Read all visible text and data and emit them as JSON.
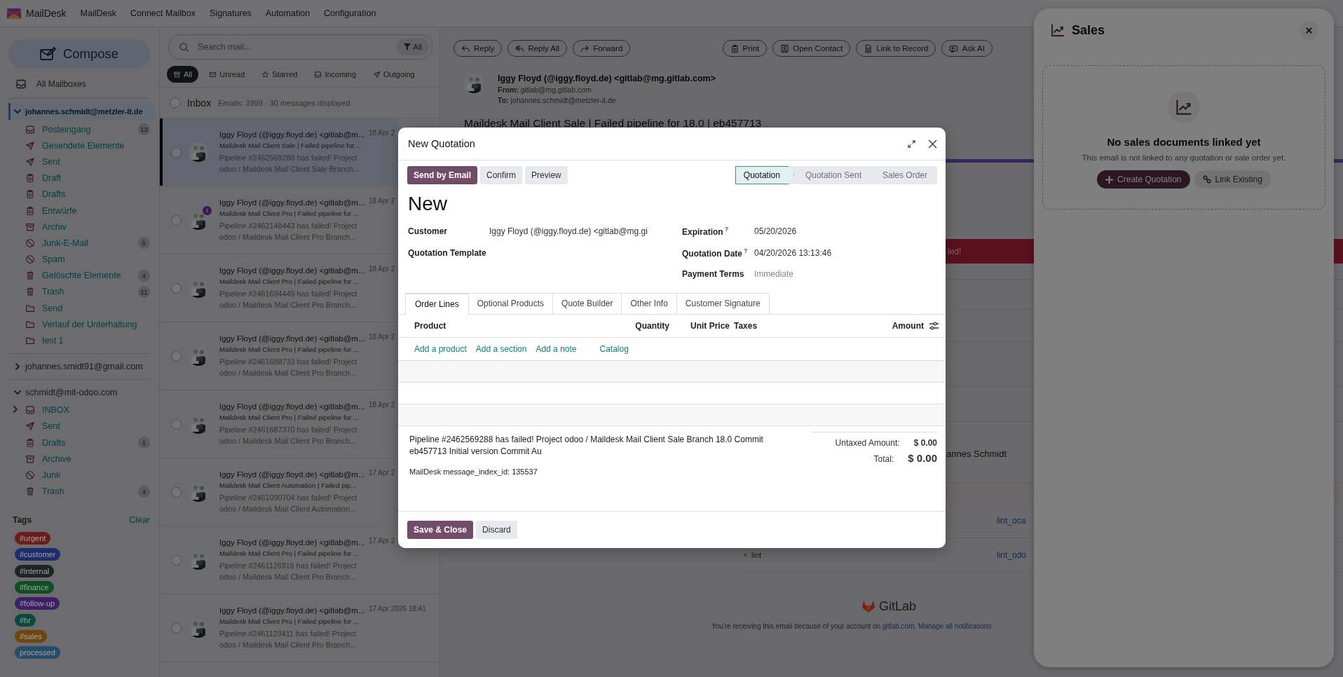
{
  "topbar": {
    "brand": "MailDesk",
    "menu": [
      "MailDesk",
      "Connect Mailbox",
      "Signatures",
      "Automation",
      "Configuration"
    ]
  },
  "sidebar": {
    "compose": "Compose",
    "all_mailboxes": "All Mailboxes",
    "accounts": [
      {
        "address": "johannes.schmidt@metzler-it.de",
        "expanded": true,
        "selected": true,
        "folders": [
          {
            "kind": "inbox",
            "name": "Posteingang",
            "count": "13"
          },
          {
            "kind": "sent",
            "name": "Gesendete Elemente"
          },
          {
            "kind": "sent",
            "name": "Sent"
          },
          {
            "kind": "draft",
            "name": "Draft"
          },
          {
            "kind": "draft",
            "name": "Drafts"
          },
          {
            "kind": "draft",
            "name": "Entwürfe"
          },
          {
            "kind": "archive",
            "name": "Archiv"
          },
          {
            "kind": "junk",
            "name": "Junk-E-Mail",
            "count": "5"
          },
          {
            "kind": "junk",
            "name": "Spam"
          },
          {
            "kind": "trash",
            "name": "Gelöschte Elemente",
            "count": "4"
          },
          {
            "kind": "trash",
            "name": "Trash",
            "count": "11"
          },
          {
            "kind": "folder",
            "name": "Send"
          },
          {
            "kind": "folder",
            "name": "Verlauf der Unterhaltung"
          },
          {
            "kind": "folder",
            "name": "test 1"
          }
        ]
      },
      {
        "address": "johannes.smidt91@gmail.com",
        "expanded": false,
        "selected": false
      },
      {
        "address": "schmidt@mit-odoo.com",
        "expanded": true,
        "selected": false,
        "folders": [
          {
            "kind": "inbox",
            "name": "INBOX",
            "expanded": false
          },
          {
            "kind": "sent",
            "name": "Sent"
          },
          {
            "kind": "draft",
            "name": "Drafts",
            "count": "1"
          },
          {
            "kind": "archive",
            "name": "Archive"
          },
          {
            "kind": "junk",
            "name": "Junk"
          },
          {
            "kind": "trash",
            "name": "Trash",
            "count": "4"
          }
        ]
      }
    ],
    "tags_title": "Tags",
    "clear": "Clear",
    "tags": [
      {
        "label": "#urgent",
        "color": "#691e1a"
      },
      {
        "label": "#customer",
        "color": "#1d2c6b"
      },
      {
        "label": "#internal",
        "color": "#1f2228"
      },
      {
        "label": "#finance",
        "color": "#104f24"
      },
      {
        "label": "#follow-up",
        "color": "#3d2065"
      },
      {
        "label": "#hr",
        "color": "#0b483d"
      },
      {
        "label": "#sales",
        "color": "#6d450e"
      },
      {
        "label": "processed",
        "color": "#274d68"
      }
    ]
  },
  "mail_list": {
    "search_placeholder": "Search mail...",
    "filter": "All",
    "chips": [
      {
        "kind": "all",
        "label": "All",
        "selected": true
      },
      {
        "kind": "unread",
        "label": "Unread",
        "selected": false
      },
      {
        "kind": "starred",
        "label": "Starred",
        "selected": false
      },
      {
        "kind": "incoming",
        "label": "Incoming",
        "selected": false
      },
      {
        "kind": "outgoing",
        "label": "Outgoing",
        "selected": false
      }
    ],
    "select_all_checked": false,
    "folder_title": "Inbox",
    "summary": "Emails: 3999 · 30 messages displayed",
    "messages": [
      {
        "sender": "Iggy Floyd (@iggy.floyd.de) <gitlab@m...",
        "date": "18 Apr 2",
        "subject": "Maildesk Mail Client Sale | Failed pipeline for...",
        "preview": "Pipeline #2462569288 has failed! Project odoo / Maildesk Mail Client Sale Branch...",
        "selected": true
      },
      {
        "sender": "Iggy Floyd (@iggy.floyd.de) <gitlab@m...",
        "date": "18 Apr 2",
        "subject": "Maildesk Mail Client Pro | Failed pipeline for ...",
        "preview": "Pipeline #2462148443 has failed! Project odoo / Maildesk Mail Client Pro Branch...",
        "selected": false,
        "badge": "1"
      },
      {
        "sender": "Iggy Floyd (@iggy.floyd.de) <gitlab@m...",
        "date": "18 Apr 2",
        "subject": "Maildesk Mail Client Pro | Failed pipeline for ...",
        "preview": "Pipeline #2461694449 has failed! Project odoo / Maildesk Mail Client Pro Branch...",
        "selected": false
      },
      {
        "sender": "Iggy Floyd (@iggy.floyd.de) <gitlab@m...",
        "date": "18 Apr 2",
        "subject": "Maildesk Mail Client Pro | Failed pipeline for ...",
        "preview": "Pipeline #2461688733 has failed! Project odoo / Maildesk Mail Client Pro Branch...",
        "selected": false
      },
      {
        "sender": "Iggy Floyd (@iggy.floyd.de) <gitlab@m...",
        "date": "18 Apr 2",
        "subject": "Maildesk Mail Client Pro | Failed pipeline for ...",
        "preview": "Pipeline #2461687370 has failed! Project odoo / Maildesk Mail Client Pro Branch...",
        "selected": false
      },
      {
        "sender": "Iggy Floyd (@iggy.floyd.de) <gitlab@m...",
        "date": "17 Apr 2",
        "subject": "Maildesk Mail Client Automation | Failed pip...",
        "preview": "Pipeline #2461090704 has failed! Project odoo / Maildesk Mail Client Automation...",
        "selected": false
      },
      {
        "sender": "Iggy Floyd (@iggy.floyd.de) <gitlab@m...",
        "date": "17 Apr 2",
        "subject": "Maildesk Mail Client Pro | Failed pipeline for ...",
        "preview": "Pipeline #2461126916 has failed! Project odoo / Maildesk Mail Client Pro Branch...",
        "selected": false
      },
      {
        "sender": "Iggy Floyd (@iggy.floyd.de) <gitlab@m...",
        "date": "17 Apr 2026 18:41",
        "subject": "Maildesk Mail Client Pro | Failed pipeline for ...",
        "preview": "Pipeline #2461123411 has failed! Project odoo / Maildesk Mail Client Pro Branch...",
        "selected": false
      }
    ]
  },
  "reader": {
    "toolbar_left": [
      {
        "kind": "reply",
        "label": "Reply"
      },
      {
        "kind": "reply_all",
        "label": "Reply All"
      },
      {
        "kind": "forward",
        "label": "Forward"
      }
    ],
    "toolbar_right": [
      {
        "kind": "print",
        "label": "Print"
      },
      {
        "kind": "contact",
        "label": "Open Contact"
      },
      {
        "kind": "record",
        "label": "Link to Record"
      },
      {
        "kind": "ai",
        "label": "Ask AI"
      }
    ],
    "sender": "Iggy Floyd (@iggy.floyd.de) <gitlab@mg.gitlab.com>",
    "from_label": "From:",
    "from": "gitlab@mg.gitlab.com",
    "to_label": "To:",
    "to": "johannes.schmidt@metzler-it.de",
    "subject": "Maildesk Mail Client Sale | Failed pipeline for 18.0 | eb457713",
    "body": {
      "banner": "led!",
      "author": "annes Schmidt",
      "jobs": [
        {
          "link": "lint_oca"
        },
        {
          "status": "×",
          "name": "lint",
          "link": "lint_odo"
        }
      ],
      "brand": "GitLab",
      "footer": [
        {
          "kind": "text",
          "text": "You're receiving this email because of your account on "
        },
        {
          "kind": "link",
          "text": "gitlab.com"
        },
        {
          "kind": "text",
          "text": ". "
        },
        {
          "kind": "link",
          "text": "Manage all notifications"
        }
      ]
    }
  },
  "sales_panel": {
    "title": "Sales",
    "empty_title": "No sales documents linked yet",
    "empty_text": "This email is not linked to any quotation or sale order yet.",
    "buttons": [
      {
        "kind": "create",
        "label": "Create Quotation"
      },
      {
        "kind": "link",
        "label": "Link Existing"
      }
    ]
  },
  "quotation_modal": {
    "title": "New Quotation",
    "actions": [
      {
        "kind": "primary",
        "label": "Send by Email"
      },
      {
        "kind": "secondary",
        "label": "Confirm"
      },
      {
        "kind": "secondary",
        "label": "Preview"
      }
    ],
    "stages": [
      {
        "label": "Quotation",
        "selected": true
      },
      {
        "label": "Quotation Sent",
        "selected": false
      },
      {
        "label": "Sales Order",
        "selected": false
      }
    ],
    "record_name": "New",
    "fields_left": [
      {
        "label": "Customer",
        "value": "Iggy Floyd (@iggy.floyd.de) <gitlab@mg.gi"
      },
      {
        "label": "Quotation Template"
      }
    ],
    "fields_right": [
      {
        "label": "Expiration",
        "help": "?",
        "value": "05/20/2026"
      },
      {
        "label": "Quotation Date",
        "help": "?",
        "value": "04/20/2026 13:13:46"
      },
      {
        "label": "Payment Terms",
        "placeholder": "Immediate"
      }
    ],
    "tabs": [
      {
        "label": "Order Lines",
        "selected": true
      },
      {
        "label": "Optional Products",
        "selected": false
      },
      {
        "label": "Quote Builder",
        "selected": false
      },
      {
        "label": "Other Info",
        "selected": false
      },
      {
        "label": "Customer Signature",
        "selected": false
      }
    ],
    "columns": [
      "Product",
      "Quantity",
      "Unit Price",
      "Taxes",
      "Amount"
    ],
    "add_links": [
      "Add a product",
      "Add a section",
      "Add a note",
      "Catalog"
    ],
    "note": "Pipeline #2462569288 has failed! Project odoo / Maildesk Mail Client Sale Branch 18.0 Commit eb457713 Initial version Commit Au",
    "reference": "MailDesk message_index_id: 135537",
    "totals": [
      {
        "kind": "subtotal",
        "label": "Untaxed Amount:",
        "value": "$ 0.00"
      },
      {
        "kind": "total",
        "label": "Total:",
        "value": "$ 0.00"
      }
    ],
    "footer_buttons": [
      {
        "kind": "primary",
        "label": "Save & Close"
      },
      {
        "kind": "secondary",
        "label": "Discard"
      }
    ]
  }
}
